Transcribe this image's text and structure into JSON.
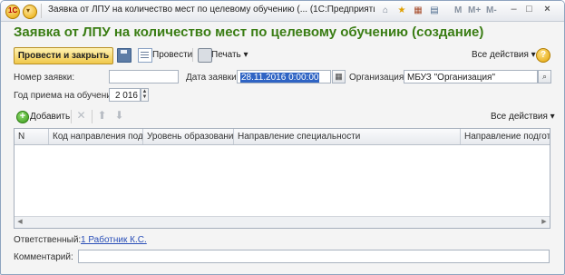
{
  "window": {
    "title": "Заявка от ЛПУ на количество мест по целевому обучению (... (1С:Предприятие)",
    "icons": [
      "1c-logo-icon",
      "main-menu-icon",
      "home-icon",
      "star-icon",
      "calendar-icon",
      "calculator-icon"
    ],
    "m_buttons": [
      "M",
      "M+",
      "M-"
    ],
    "controls": [
      "minimize",
      "maximize",
      "close"
    ]
  },
  "form": {
    "title": "Заявка от ЛПУ на количество мест по целевому обучению (создание)"
  },
  "commandbar": {
    "post_close_label": "Провести и закрыть",
    "post_label": "Провести",
    "print_label": "Печать",
    "all_actions_label": "Все действия",
    "help_label": "?"
  },
  "fields": {
    "number_label": "Номер заявки:",
    "number_value": "",
    "date_label": "Дата заявки:",
    "date_value": "28.11.2016  0:00:00",
    "org_label": "Организация:",
    "org_value": "МБУЗ \"Организация\"",
    "year_label": "Год приема на обучение:",
    "year_value": "2 016"
  },
  "table_toolbar": {
    "add_label": "Добавить",
    "all_actions_label": "Все действия"
  },
  "table": {
    "columns": [
      "N",
      "Код направления под...",
      "Уровень образования",
      "Направление специальности",
      "Направление подготов"
    ],
    "rows": []
  },
  "footer": {
    "responsible_label": "Ответственный:",
    "responsible_value": "1 Работник К.С.",
    "comment_label": "Комментарий:",
    "comment_value": ""
  }
}
